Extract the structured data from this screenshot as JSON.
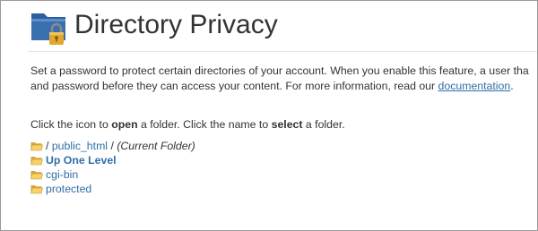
{
  "header": {
    "title": "Directory Privacy",
    "icon": "folder-lock-icon",
    "colors": {
      "folder": "#3a6fb0",
      "lock": "#e2a72e"
    }
  },
  "description": {
    "line1": "Set a password to protect certain directories of your account. When you enable this feature, a user tha",
    "line2_before_link": "and password before they can access your content. For more information, read our ",
    "link_text": "documentation",
    "line2_after_link": "."
  },
  "instructions": {
    "part1": "Click the icon to ",
    "open_word": "open",
    "part2": " a folder. Click the name to ",
    "select_word": "select",
    "part3": " a folder."
  },
  "folders": {
    "current": {
      "separator_before": "/",
      "name": "public_html",
      "separator_after": "/",
      "note": "(Current Folder)"
    },
    "up_one_level": "Up One Level",
    "items": [
      "cgi-bin",
      "protected"
    ]
  },
  "colors": {
    "link": "#2f6ea7",
    "text": "#333333",
    "folder_icon": "#f0c75a"
  }
}
